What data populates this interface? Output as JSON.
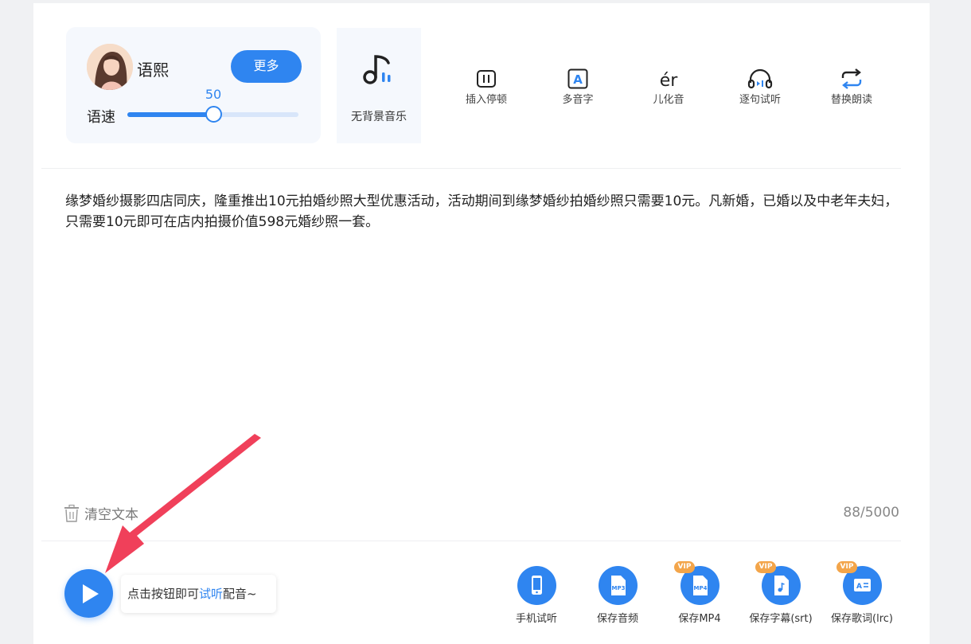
{
  "voice": {
    "name": "语熙",
    "more_label": "更多",
    "speed_label": "语速",
    "speed_value": "50",
    "speed_fraction": 0.5
  },
  "bgm": {
    "label": "无背景音乐",
    "icon": "music-note-icon"
  },
  "tools": [
    {
      "label": "插入停顿",
      "icon": "pause-insert-icon"
    },
    {
      "label": "多音字",
      "icon": "polyphone-icon"
    },
    {
      "label": "儿化音",
      "icon": "erhua-icon",
      "icon_text": "ér"
    },
    {
      "label": "逐句试听",
      "icon": "headphones-icon"
    },
    {
      "label": "替换朗读",
      "icon": "replace-loop-icon"
    }
  ],
  "editor": {
    "text": "缘梦婚纱摄影四店同庆，隆重推出10元拍婚纱照大型优惠活动，活动期间到缘梦婚纱拍婚纱照只需要10元。凡新婚，已婚以及中老年夫妇，只需要10元即可在店内拍摄价值598元婚纱照一套。",
    "clear_label": "清空文本",
    "char_count": "88/5000"
  },
  "player": {
    "tip_prefix": "点击按钮即可",
    "tip_highlight": "试听",
    "tip_suffix": "配音~"
  },
  "save_actions": [
    {
      "label": "手机试听",
      "icon": "phone-icon",
      "vip": ""
    },
    {
      "label": "保存音频",
      "icon": "mp3-file-icon",
      "icon_text": "MP3",
      "vip": ""
    },
    {
      "label": "保存MP4",
      "icon": "mp4-file-icon",
      "icon_text": "MP4",
      "vip": "VIP"
    },
    {
      "label": "保存字幕(srt)",
      "icon": "subtitle-file-icon",
      "vip": "VIP"
    },
    {
      "label": "保存歌词(lrc)",
      "icon": "lyrics-file-icon",
      "vip": "VIP"
    }
  ],
  "colors": {
    "accent": "#2f85f0",
    "vip": "#f3a54a",
    "arrow": "#f0405a"
  }
}
